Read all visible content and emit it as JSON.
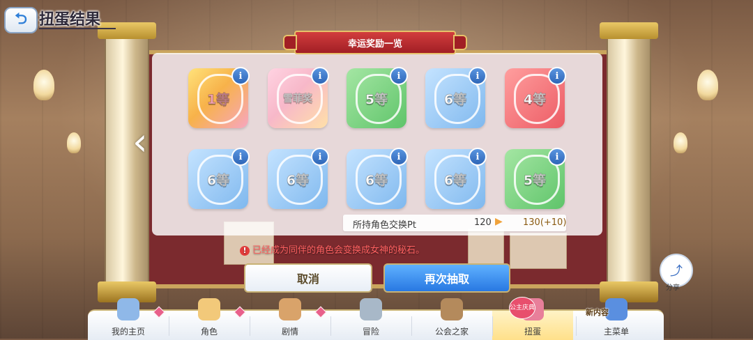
{
  "header": {
    "title": "扭蛋结果",
    "back_icon": "back-arrow-icon"
  },
  "dialog": {
    "title": "幸运奖励一览",
    "prizes": [
      {
        "rank": "1等",
        "tier": "gold"
      },
      {
        "rank": "雪菲奖",
        "tier": "pink"
      },
      {
        "rank": "5等",
        "tier": "green"
      },
      {
        "rank": "6等",
        "tier": "blue"
      },
      {
        "rank": "4等",
        "tier": "red"
      },
      {
        "rank": "6等",
        "tier": "blue"
      },
      {
        "rank": "6等",
        "tier": "blue"
      },
      {
        "rank": "6等",
        "tier": "blue"
      },
      {
        "rank": "6等",
        "tier": "blue"
      },
      {
        "rank": "5等",
        "tier": "green"
      }
    ],
    "info_glyph": "i",
    "pt": {
      "label": "所持角色交换Pt",
      "from": "120",
      "to": "130(+10)"
    },
    "notice": "已经成为同伴的角色会变换成女神的秘石。"
  },
  "buttons": {
    "cancel": "取消",
    "draw_again": "再次抽取"
  },
  "share": {
    "label": "分享"
  },
  "bottom_nav": {
    "items": [
      {
        "label": "我的主页",
        "badge": true
      },
      {
        "label": "角色",
        "badge": true
      },
      {
        "label": "剧情",
        "badge": true
      },
      {
        "label": "冒险",
        "badge": false
      },
      {
        "label": "公会之家",
        "badge": false
      },
      {
        "label": "扭蛋",
        "badge": false,
        "active": true
      },
      {
        "label": "主菜单",
        "badge": false
      }
    ],
    "new_content_tag": "新内容",
    "fest_tag": "公主庆典"
  },
  "colors": {
    "accent_blue": "#2878e2",
    "banner_red": "#a11f25",
    "gold_trim": "#c8b274",
    "notice_red": "#ff6161"
  }
}
